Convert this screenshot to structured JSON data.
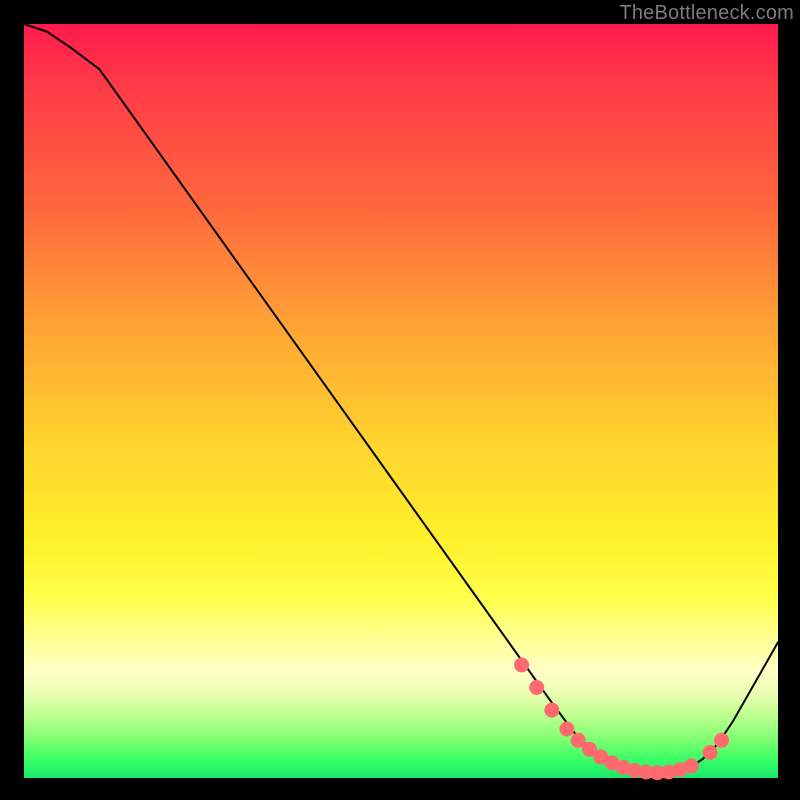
{
  "watermark": "TheBottleneck.com",
  "colors": {
    "curve_stroke": "#000000",
    "marker_fill": "#ff6a6f",
    "marker_stroke": "#ff6a6f"
  },
  "chart_data": {
    "type": "line",
    "title": "",
    "xlabel": "",
    "ylabel": "",
    "xlim": [
      0,
      100
    ],
    "ylim": [
      0,
      100
    ],
    "series": [
      {
        "name": "bottleneck-curve",
        "x": [
          0,
          3,
          6,
          10,
          20,
          30,
          40,
          50,
          60,
          65,
          70,
          73,
          76,
          78,
          80,
          82,
          84,
          86,
          88,
          90,
          92,
          94,
          100
        ],
        "y": [
          100,
          99,
          97,
          94,
          80,
          66,
          52,
          38,
          24,
          17,
          10,
          6,
          3,
          1.5,
          0.8,
          0.5,
          0.5,
          0.6,
          1.2,
          2.5,
          4.5,
          7.5,
          18
        ]
      }
    ],
    "markers": {
      "name": "valley-markers",
      "x": [
        66,
        68,
        70,
        72,
        73.5,
        75,
        76.5,
        78,
        79.5,
        81,
        82.5,
        84,
        85.5,
        87,
        88.5,
        91,
        92.5
      ],
      "y": [
        15,
        12,
        9,
        6.5,
        5,
        3.8,
        2.8,
        2,
        1.4,
        1,
        0.8,
        0.7,
        0.8,
        1.1,
        1.6,
        3.4,
        5
      ]
    }
  }
}
